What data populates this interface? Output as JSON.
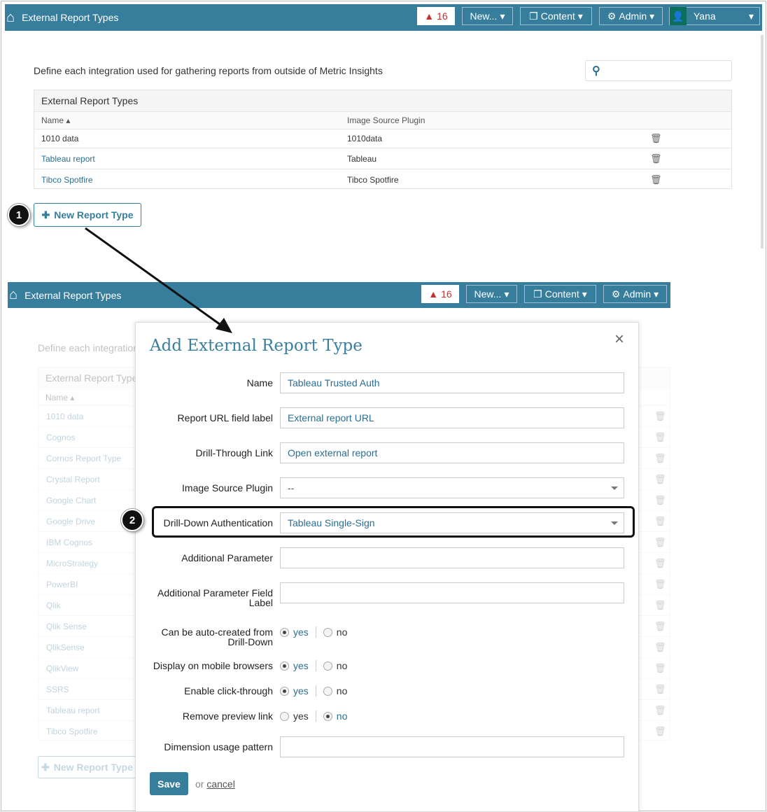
{
  "header": {
    "title": "External Report Types",
    "alert_count": "16",
    "new_label": "New...",
    "content_label": "Content",
    "admin_label": "Admin",
    "user_name": "Yana"
  },
  "page": {
    "description": "Define each integration used for gathering reports from outside of Metric Insights",
    "search_placeholder": "",
    "table_title": "External Report Types",
    "col_name": "Name",
    "col_plugin": "Image Source Plugin",
    "new_button": "New Report Type"
  },
  "top_rows": [
    {
      "name": "1010 data",
      "plugin": "1010data"
    },
    {
      "name": "Tableau report",
      "plugin": "Tableau"
    },
    {
      "name": "Tibco Spotfire",
      "plugin": "Tibco Spotfire"
    }
  ],
  "bg_description": "Define each integration",
  "bg_table_title": "External Report Type",
  "bg_rows": [
    "1010 data",
    "Cognos",
    "Cornos Report Type",
    "Crystal Report",
    "Google Chart",
    "Google Drive",
    "IBM Cognos",
    "MicroStrategy",
    "PowerBI",
    "Qlik",
    "Qlik Sense",
    "QlikSense",
    "QlikView",
    "SSRS",
    "Tableau report",
    "Tibco Spotfire"
  ],
  "bg_new_button": "New Report Type",
  "callouts": {
    "one": "1",
    "two": "2"
  },
  "modal": {
    "title": "Add External Report Type",
    "close": "×",
    "fields": {
      "name": {
        "label": "Name",
        "value": "Tableau Trusted Auth"
      },
      "url_label": {
        "label": "Report URL field label",
        "value": "External report URL"
      },
      "drill_link": {
        "label": "Drill-Through Link",
        "value": "Open external report"
      },
      "plugin": {
        "label": "Image Source Plugin",
        "value": "--"
      },
      "auth": {
        "label": "Drill-Down Authentication",
        "value": "Tableau Single-Sign"
      },
      "add_param": {
        "label": "Additional Parameter",
        "value": ""
      },
      "add_param_label": {
        "label": "Additional Parameter Field Label",
        "value": ""
      },
      "auto_created": {
        "label": "Can be auto-created from Drill-Down",
        "selected": "yes"
      },
      "mobile": {
        "label": "Display on mobile browsers",
        "selected": "yes"
      },
      "click_through": {
        "label": "Enable click-through",
        "selected": "yes"
      },
      "remove_preview": {
        "label": "Remove preview link",
        "selected": "no"
      },
      "dimension": {
        "label": "Dimension usage pattern",
        "value": ""
      }
    },
    "yes": "yes",
    "no": "no",
    "save": "Save",
    "or": "or",
    "cancel": "cancel"
  }
}
